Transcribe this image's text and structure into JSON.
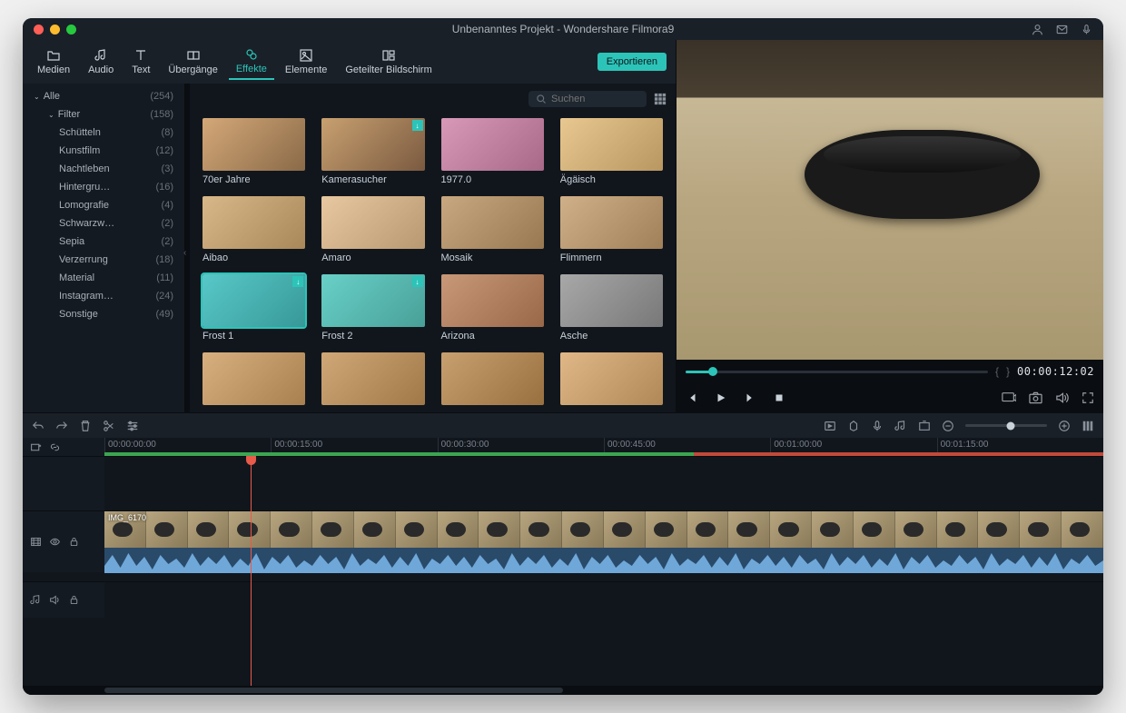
{
  "window": {
    "title": "Unbenanntes Projekt - Wondershare Filmora9"
  },
  "tabs": {
    "items": [
      {
        "id": "medien",
        "label": "Medien"
      },
      {
        "id": "audio",
        "label": "Audio"
      },
      {
        "id": "text",
        "label": "Text"
      },
      {
        "id": "uebergaenge",
        "label": "Übergänge"
      },
      {
        "id": "effekte",
        "label": "Effekte"
      },
      {
        "id": "elemente",
        "label": "Elemente"
      },
      {
        "id": "split",
        "label": "Geteilter Bildschirm"
      }
    ],
    "active": "effekte",
    "export_label": "Exportieren"
  },
  "sidebar": {
    "items": [
      {
        "label": "Alle",
        "count": "(254)",
        "level": 0,
        "expanded": true
      },
      {
        "label": "Filter",
        "count": "(158)",
        "level": 1,
        "expanded": true
      },
      {
        "label": "Schütteln",
        "count": "(8)",
        "level": 2
      },
      {
        "label": "Kunstfilm",
        "count": "(12)",
        "level": 2
      },
      {
        "label": "Nachtleben",
        "count": "(3)",
        "level": 2
      },
      {
        "label": "Hintergru…",
        "count": "(16)",
        "level": 2
      },
      {
        "label": "Lomografie",
        "count": "(4)",
        "level": 2
      },
      {
        "label": "Schwarzw…",
        "count": "(2)",
        "level": 2
      },
      {
        "label": "Sepia",
        "count": "(2)",
        "level": 2
      },
      {
        "label": "Verzerrung",
        "count": "(18)",
        "level": 2
      },
      {
        "label": "Material",
        "count": "(11)",
        "level": 2
      },
      {
        "label": "Instagram…",
        "count": "(24)",
        "level": 2
      },
      {
        "label": "Sonstige",
        "count": "(49)",
        "level": 2
      }
    ]
  },
  "search": {
    "placeholder": "Suchen"
  },
  "effects": {
    "items": [
      {
        "label": "70er Jahre",
        "tint": "linear-gradient(135deg,#d4a878,#8a6a48)",
        "dl": false
      },
      {
        "label": "Kamerasucher",
        "tint": "linear-gradient(135deg,#c8a070,#7a5a40)",
        "dl": true
      },
      {
        "label": "1977.0",
        "tint": "linear-gradient(135deg,#d898b8,#a86888)",
        "dl": false
      },
      {
        "label": "Ägäisch",
        "tint": "linear-gradient(135deg,#e8c890,#b89860)",
        "dl": false
      },
      {
        "label": "Aibao",
        "tint": "linear-gradient(135deg,#d8b888,#a88858)",
        "dl": false
      },
      {
        "label": "Amaro",
        "tint": "linear-gradient(135deg,#e8c8a0,#b89870)",
        "dl": false
      },
      {
        "label": "Mosaik",
        "tint": "linear-gradient(135deg,#c8a880,#987850)",
        "dl": false
      },
      {
        "label": "Flimmern",
        "tint": "linear-gradient(135deg,#d0b088,#a08058)",
        "dl": false
      },
      {
        "label": "Frost 1",
        "tint": "linear-gradient(135deg,#58c8c8,#389898)",
        "dl": true,
        "sel": true
      },
      {
        "label": "Frost 2",
        "tint": "linear-gradient(135deg,#68d0c8,#48a098)",
        "dl": true
      },
      {
        "label": "Arizona",
        "tint": "linear-gradient(135deg,#c89878,#986848)",
        "dl": false
      },
      {
        "label": "Asche",
        "tint": "linear-gradient(135deg,#a8a8a8,#787878)",
        "dl": false
      },
      {
        "label": "",
        "tint": "linear-gradient(135deg,#d8b080,#a88050)",
        "dl": false
      },
      {
        "label": "",
        "tint": "linear-gradient(135deg,#d0a878,#a07848)",
        "dl": false
      },
      {
        "label": "",
        "tint": "linear-gradient(135deg,#c8a070,#987040)",
        "dl": false
      },
      {
        "label": "",
        "tint": "linear-gradient(135deg,#e0b888,#b08858)",
        "dl": false
      }
    ]
  },
  "preview": {
    "timecode": "00:00:12:02",
    "scrub_percent": 9
  },
  "timeline": {
    "ruler": [
      "00:00:00:00",
      "00:00:15:00",
      "00:00:30:00",
      "00:00:45:00",
      "00:01:00:00",
      "00:01:15:00"
    ],
    "playhead_percent": 13.5,
    "clip_label": "IMG_6170"
  }
}
